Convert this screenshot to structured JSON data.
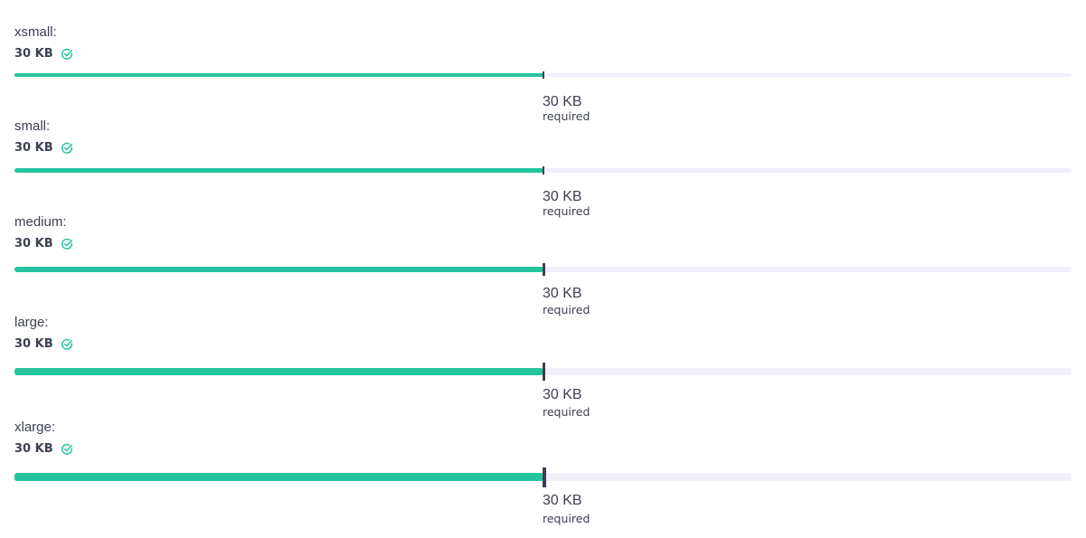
{
  "accent_color": "#25c49f",
  "track_color": "#f0effa",
  "marker_color": "#3d4052",
  "rows": [
    {
      "label": "xsmall:",
      "value": "30 KB",
      "status_icon": "check-circle-icon",
      "required_value": "30 KB",
      "required_label": "required",
      "progress_fraction": 0.5
    },
    {
      "label": "small:",
      "value": "30 KB",
      "status_icon": "check-circle-icon",
      "required_value": "30 KB",
      "required_label": "required",
      "progress_fraction": 0.5
    },
    {
      "label": "medium:",
      "value": "30 KB",
      "status_icon": "check-circle-icon",
      "required_value": "30 KB",
      "required_label": "required",
      "progress_fraction": 0.5
    },
    {
      "label": "large:",
      "value": "30 KB",
      "status_icon": "check-circle-icon",
      "required_value": "30 KB",
      "required_label": "required",
      "progress_fraction": 0.5
    },
    {
      "label": "xlarge:",
      "value": "30 KB",
      "status_icon": "check-circle-icon",
      "required_value": "30 KB",
      "required_label": "required",
      "progress_fraction": 0.5
    }
  ]
}
